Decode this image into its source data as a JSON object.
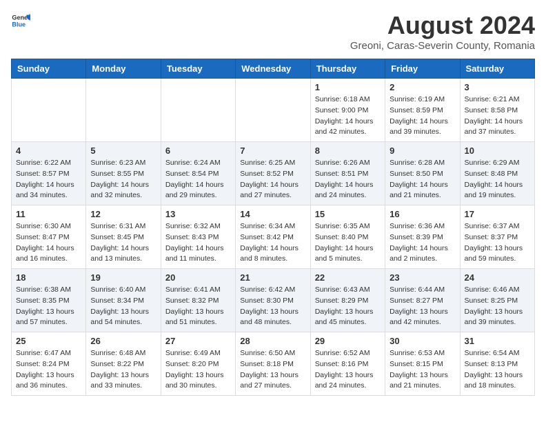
{
  "header": {
    "logo_general": "General",
    "logo_blue": "Blue",
    "main_title": "August 2024",
    "subtitle": "Greoni, Caras-Severin County, Romania"
  },
  "weekdays": [
    "Sunday",
    "Monday",
    "Tuesday",
    "Wednesday",
    "Thursday",
    "Friday",
    "Saturday"
  ],
  "weeks": [
    [
      {
        "day": "",
        "info": ""
      },
      {
        "day": "",
        "info": ""
      },
      {
        "day": "",
        "info": ""
      },
      {
        "day": "",
        "info": ""
      },
      {
        "day": "1",
        "info": "Sunrise: 6:18 AM\nSunset: 9:00 PM\nDaylight: 14 hours and 42 minutes."
      },
      {
        "day": "2",
        "info": "Sunrise: 6:19 AM\nSunset: 8:59 PM\nDaylight: 14 hours and 39 minutes."
      },
      {
        "day": "3",
        "info": "Sunrise: 6:21 AM\nSunset: 8:58 PM\nDaylight: 14 hours and 37 minutes."
      }
    ],
    [
      {
        "day": "4",
        "info": "Sunrise: 6:22 AM\nSunset: 8:57 PM\nDaylight: 14 hours and 34 minutes."
      },
      {
        "day": "5",
        "info": "Sunrise: 6:23 AM\nSunset: 8:55 PM\nDaylight: 14 hours and 32 minutes."
      },
      {
        "day": "6",
        "info": "Sunrise: 6:24 AM\nSunset: 8:54 PM\nDaylight: 14 hours and 29 minutes."
      },
      {
        "day": "7",
        "info": "Sunrise: 6:25 AM\nSunset: 8:52 PM\nDaylight: 14 hours and 27 minutes."
      },
      {
        "day": "8",
        "info": "Sunrise: 6:26 AM\nSunset: 8:51 PM\nDaylight: 14 hours and 24 minutes."
      },
      {
        "day": "9",
        "info": "Sunrise: 6:28 AM\nSunset: 8:50 PM\nDaylight: 14 hours and 21 minutes."
      },
      {
        "day": "10",
        "info": "Sunrise: 6:29 AM\nSunset: 8:48 PM\nDaylight: 14 hours and 19 minutes."
      }
    ],
    [
      {
        "day": "11",
        "info": "Sunrise: 6:30 AM\nSunset: 8:47 PM\nDaylight: 14 hours and 16 minutes."
      },
      {
        "day": "12",
        "info": "Sunrise: 6:31 AM\nSunset: 8:45 PM\nDaylight: 14 hours and 13 minutes."
      },
      {
        "day": "13",
        "info": "Sunrise: 6:32 AM\nSunset: 8:43 PM\nDaylight: 14 hours and 11 minutes."
      },
      {
        "day": "14",
        "info": "Sunrise: 6:34 AM\nSunset: 8:42 PM\nDaylight: 14 hours and 8 minutes."
      },
      {
        "day": "15",
        "info": "Sunrise: 6:35 AM\nSunset: 8:40 PM\nDaylight: 14 hours and 5 minutes."
      },
      {
        "day": "16",
        "info": "Sunrise: 6:36 AM\nSunset: 8:39 PM\nDaylight: 14 hours and 2 minutes."
      },
      {
        "day": "17",
        "info": "Sunrise: 6:37 AM\nSunset: 8:37 PM\nDaylight: 13 hours and 59 minutes."
      }
    ],
    [
      {
        "day": "18",
        "info": "Sunrise: 6:38 AM\nSunset: 8:35 PM\nDaylight: 13 hours and 57 minutes."
      },
      {
        "day": "19",
        "info": "Sunrise: 6:40 AM\nSunset: 8:34 PM\nDaylight: 13 hours and 54 minutes."
      },
      {
        "day": "20",
        "info": "Sunrise: 6:41 AM\nSunset: 8:32 PM\nDaylight: 13 hours and 51 minutes."
      },
      {
        "day": "21",
        "info": "Sunrise: 6:42 AM\nSunset: 8:30 PM\nDaylight: 13 hours and 48 minutes."
      },
      {
        "day": "22",
        "info": "Sunrise: 6:43 AM\nSunset: 8:29 PM\nDaylight: 13 hours and 45 minutes."
      },
      {
        "day": "23",
        "info": "Sunrise: 6:44 AM\nSunset: 8:27 PM\nDaylight: 13 hours and 42 minutes."
      },
      {
        "day": "24",
        "info": "Sunrise: 6:46 AM\nSunset: 8:25 PM\nDaylight: 13 hours and 39 minutes."
      }
    ],
    [
      {
        "day": "25",
        "info": "Sunrise: 6:47 AM\nSunset: 8:24 PM\nDaylight: 13 hours and 36 minutes."
      },
      {
        "day": "26",
        "info": "Sunrise: 6:48 AM\nSunset: 8:22 PM\nDaylight: 13 hours and 33 minutes."
      },
      {
        "day": "27",
        "info": "Sunrise: 6:49 AM\nSunset: 8:20 PM\nDaylight: 13 hours and 30 minutes."
      },
      {
        "day": "28",
        "info": "Sunrise: 6:50 AM\nSunset: 8:18 PM\nDaylight: 13 hours and 27 minutes."
      },
      {
        "day": "29",
        "info": "Sunrise: 6:52 AM\nSunset: 8:16 PM\nDaylight: 13 hours and 24 minutes."
      },
      {
        "day": "30",
        "info": "Sunrise: 6:53 AM\nSunset: 8:15 PM\nDaylight: 13 hours and 21 minutes."
      },
      {
        "day": "31",
        "info": "Sunrise: 6:54 AM\nSunset: 8:13 PM\nDaylight: 13 hours and 18 minutes."
      }
    ]
  ]
}
